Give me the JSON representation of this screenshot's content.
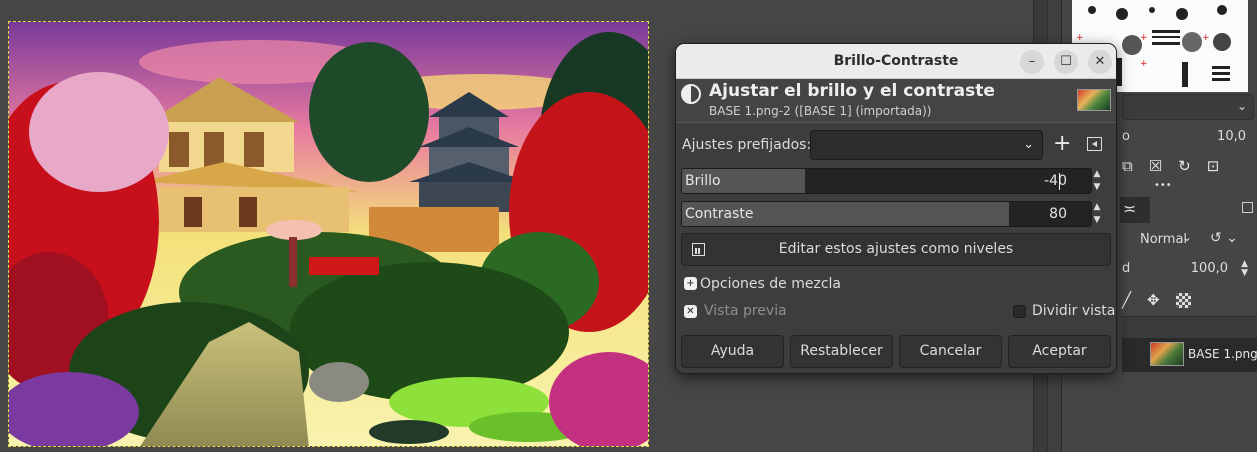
{
  "dialog": {
    "title": "Brillo-Contraste",
    "window_buttons": {
      "minimize": "–",
      "maximize": "☐",
      "close": "✕"
    },
    "heading": "Ajustar el brillo y el contraste",
    "subtitle": "BASE 1.png-2 ([BASE 1] (importada))",
    "presets_label": "Ajustes prefijados:",
    "presets_value": "",
    "add_preset_icon": "+",
    "brightness": {
      "label": "Brillo",
      "value": "-40",
      "level": 0.3
    },
    "contrast": {
      "label": "Contraste",
      "value": "80",
      "level": 0.8
    },
    "edit_levels_label": "Editar estos ajustes como niveles",
    "blend_options_label": "Opciones de mezcla",
    "preview_label": "Vista previa",
    "split_view_label": "Dividir vista",
    "buttons": {
      "help": "Ayuda",
      "reset": "Restablecer",
      "cancel": "Cancelar",
      "ok": "Aceptar"
    }
  },
  "dock": {
    "spacing_label": "o",
    "spacing_value": "10,0",
    "mode_value": "Normal",
    "opacity_label": "d",
    "opacity_value": "100,0",
    "layer_name": "BASE 1.png",
    "more_dots": "•••"
  },
  "colors": {
    "background": "#454545",
    "dialog_bg": "#3d3d3d",
    "titlebar": "#ebebeb",
    "selection_outline": "#e6d94a"
  }
}
